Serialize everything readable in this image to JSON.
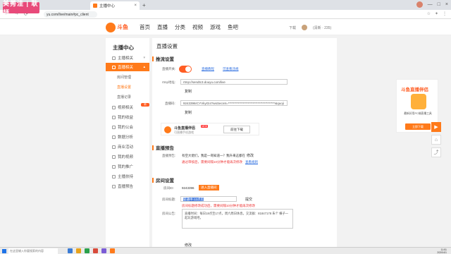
{
  "overlay": {
    "badge": "美莠洼 | 耿颉"
  },
  "browser": {
    "tab_title": "主播中心",
    "tab_close": "×",
    "new_tab": "+",
    "url": "yu.com/live/main#pc_client",
    "nav_back": "←",
    "nav_forward": "→",
    "nav_reload": "⟳",
    "window_controls": [
      "—",
      "□",
      "×"
    ]
  },
  "site": {
    "logo_text": "斗鱼",
    "nav": [
      "首页",
      "直播",
      "分类",
      "视频",
      "游戏",
      "鱼吧"
    ],
    "right": [
      "下载",
      "(清新 · 235)"
    ]
  },
  "sidebar": {
    "title": "主播中心",
    "items": [
      {
        "label": "主播相关"
      },
      {
        "label": "直播相关"
      },
      {
        "label": "视频相关"
      },
      {
        "label": "我的收益"
      },
      {
        "label": "我的公会"
      },
      {
        "label": "数据分析"
      },
      {
        "label": "商业活动"
      },
      {
        "label": "我的视频"
      },
      {
        "label": "我的推广"
      },
      {
        "label": "主播扶持"
      },
      {
        "label": "直播预告"
      }
    ],
    "subitems": [
      "房间管理",
      "直播设置",
      "直播记录"
    ],
    "tag": "新"
  },
  "main": {
    "title": "直播设置",
    "stream_section": "推流设置",
    "live_switch_label": "直播开关:",
    "tutorial_link": "直播教程",
    "rtmp_link": "可查看违规",
    "rtmp_label": "rtmp地址:",
    "rtmp_value": "rtmp://sendtc3.douyu.com/live",
    "copy1": "复制",
    "code_label": "直播码:",
    "code_value": "9243396rCYVkyGI4?wsSecret=**************************************&quoji",
    "copy2": "复制",
    "tool_title": "斗鱼直播伴侣",
    "tool_new": "NEW",
    "tool_sub": "可直播手机游戏",
    "tool_download": "前往下载",
    "preview_section": "直播预告",
    "preview_label": "直播预告:",
    "preview_text": "有空大佬们，我是一哥知道一？我升来这都在",
    "preview_btn": "修改",
    "preview_notice": "通过审核后，需要间隔10分钟才能再次修改",
    "preview_link": "查看规则",
    "room_section": "房间设置",
    "room_id_label": "房间ID:",
    "room_id_value": "9243396",
    "room_id_btn": "进入直播间",
    "room_title_label": "房间标题:",
    "room_title_value": "斩通中-12点见",
    "room_title_btn": "提交",
    "room_title_notice": "房间标题修改成功后，需要间隔10分钟才能再次修改",
    "announce_label": "房间公告:",
    "announce_text": "直播时间：每日18点至17点，周六周日休息。交流群：81847178 朱个 横子一起玩游戏吧。",
    "announce_btn": "修改"
  },
  "right_panel": {
    "title": "斗鱼直播伴侣",
    "desc": "最新好用PC端直播工具",
    "button": "立即下载"
  },
  "side_buttons": [
    "▶",
    "⌂",
    "⤴"
  ],
  "taskbar": {
    "search": "在这里输入你要搜索的内容",
    "time": "11:51",
    "date": "2020/4/1"
  },
  "colors": {
    "accent": "#ff7a1a",
    "brand_red": "#ff5d23",
    "link": "#2b6de0"
  }
}
